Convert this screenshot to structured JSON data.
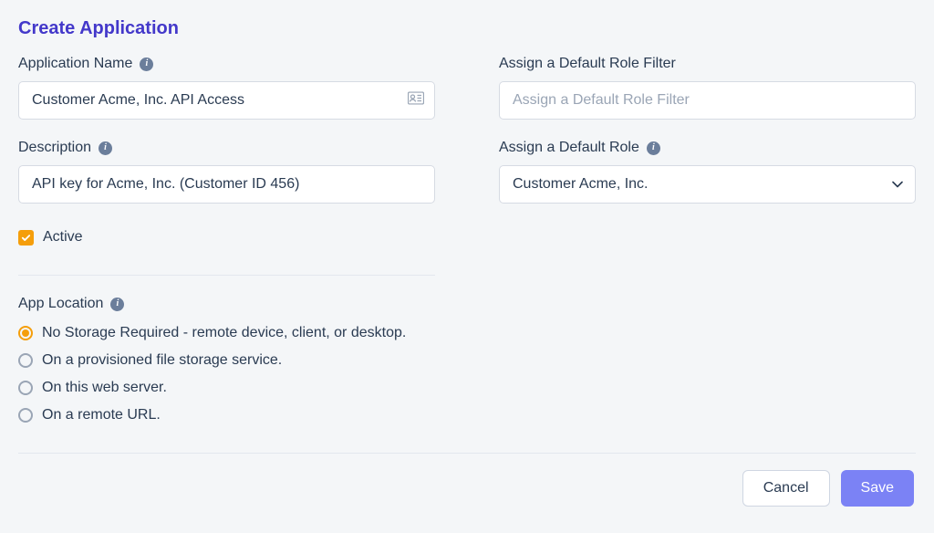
{
  "page_title": "Create Application",
  "left": {
    "app_name": {
      "label": "Application Name",
      "value": "Customer Acme, Inc. API Access"
    },
    "description": {
      "label": "Description",
      "value": "API key for Acme, Inc. (Customer ID 456)"
    },
    "active": {
      "label": "Active",
      "checked": true
    },
    "app_location": {
      "label": "App Location",
      "options": [
        "No Storage Required - remote device, client, or desktop.",
        "On a provisioned file storage service.",
        "On this web server.",
        "On a remote URL."
      ],
      "selected_index": 0
    }
  },
  "right": {
    "role_filter": {
      "label": "Assign a Default Role Filter",
      "placeholder": "Assign a Default Role Filter"
    },
    "role": {
      "label": "Assign a Default Role",
      "selected": "Customer Acme, Inc."
    }
  },
  "actions": {
    "cancel": "Cancel",
    "save": "Save"
  }
}
